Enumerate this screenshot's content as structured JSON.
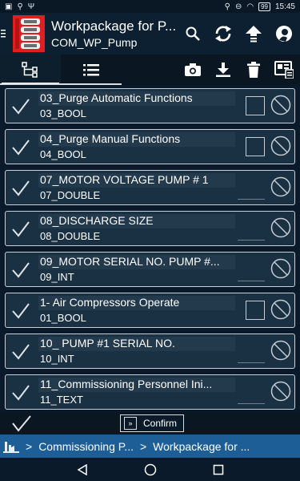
{
  "status_bar": {
    "battery": "99",
    "time": "15:45"
  },
  "app_bar": {
    "title": "Workpackage for P...",
    "subtitle": "COM_WP_Pump"
  },
  "list": {
    "items": [
      {
        "name": "03_Purge Automatic Functions",
        "code": "03_BOOL",
        "control": "checkbox"
      },
      {
        "name": "04_Purge Manual Functions",
        "code": "04_BOOL",
        "control": "checkbox"
      },
      {
        "name": "07_MOTOR VOLTAGE PUMP # 1",
        "code": "07_DOUBLE",
        "control": "input"
      },
      {
        "name": "08_DISCHARGE SIZE",
        "code": "08_DOUBLE",
        "control": "input"
      },
      {
        "name": "09_MOTOR SERIAL NO. PUMP #...",
        "code": "09_INT",
        "control": "input"
      },
      {
        "name": "1- Air Compressors Operate",
        "code": "01_BOOL",
        "control": "checkbox"
      },
      {
        "name": "10_ PUMP #1 SERIAL NO.",
        "code": "10_INT",
        "control": "input"
      },
      {
        "name": "11_Commissioning Personnel Ini...",
        "code": "11_TEXT",
        "control": "input"
      }
    ]
  },
  "bottom_bar": {
    "confirm_label": "Confirm"
  },
  "breadcrumb": {
    "sep1": ">",
    "crumb1": "Commissioning P...",
    "sep2": ">",
    "crumb2": "Workpackage for ..."
  },
  "colors": {
    "background": "#0b1a2a",
    "item_bg": "#1a3043",
    "breadcrumb_bg": "#1d5e96",
    "logo_red": "#e02020"
  }
}
